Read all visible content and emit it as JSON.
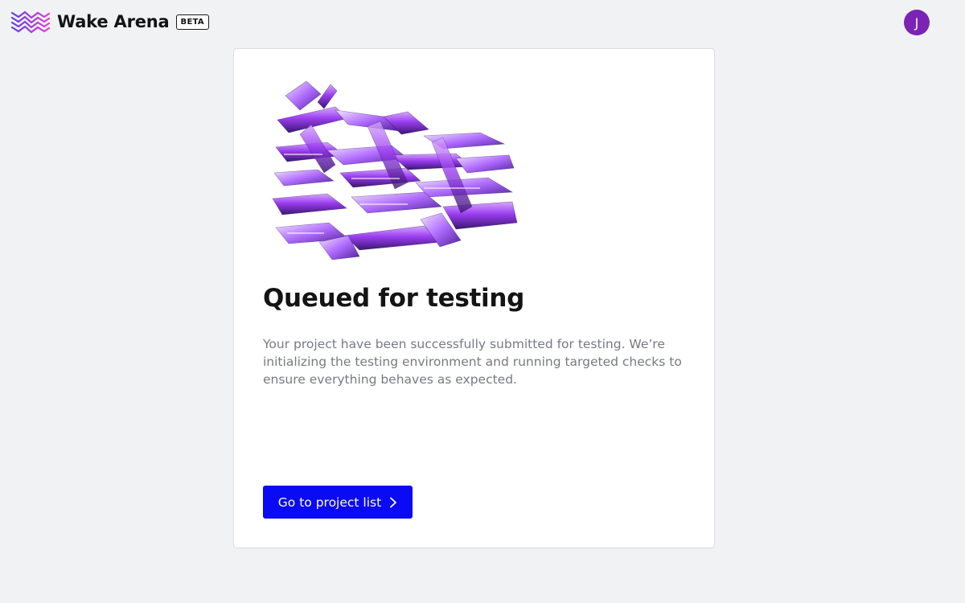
{
  "app": {
    "name": "Wake Arena",
    "badge": "BETA"
  },
  "user": {
    "avatar_initial": "J",
    "avatar_color": "#7b23b5"
  },
  "status": {
    "title": "Queued for testing",
    "description": "Your project have been successfully submitted for testing. We’re initializing the testing environment and running targeted checks to ensure everything behaves as expected."
  },
  "actions": {
    "primary_label": "Go to project list"
  },
  "icons": {
    "logo": "wave-logo-icon",
    "illustration": "crystal-blocks-illustration",
    "cta_arrow": "chevron-right-icon"
  },
  "colors": {
    "background": "#f1f2f4",
    "card": "#ffffff",
    "accent": "#0a0af5",
    "brand_purple": "#9b3cf0",
    "brand_pink": "#e63ad1"
  }
}
